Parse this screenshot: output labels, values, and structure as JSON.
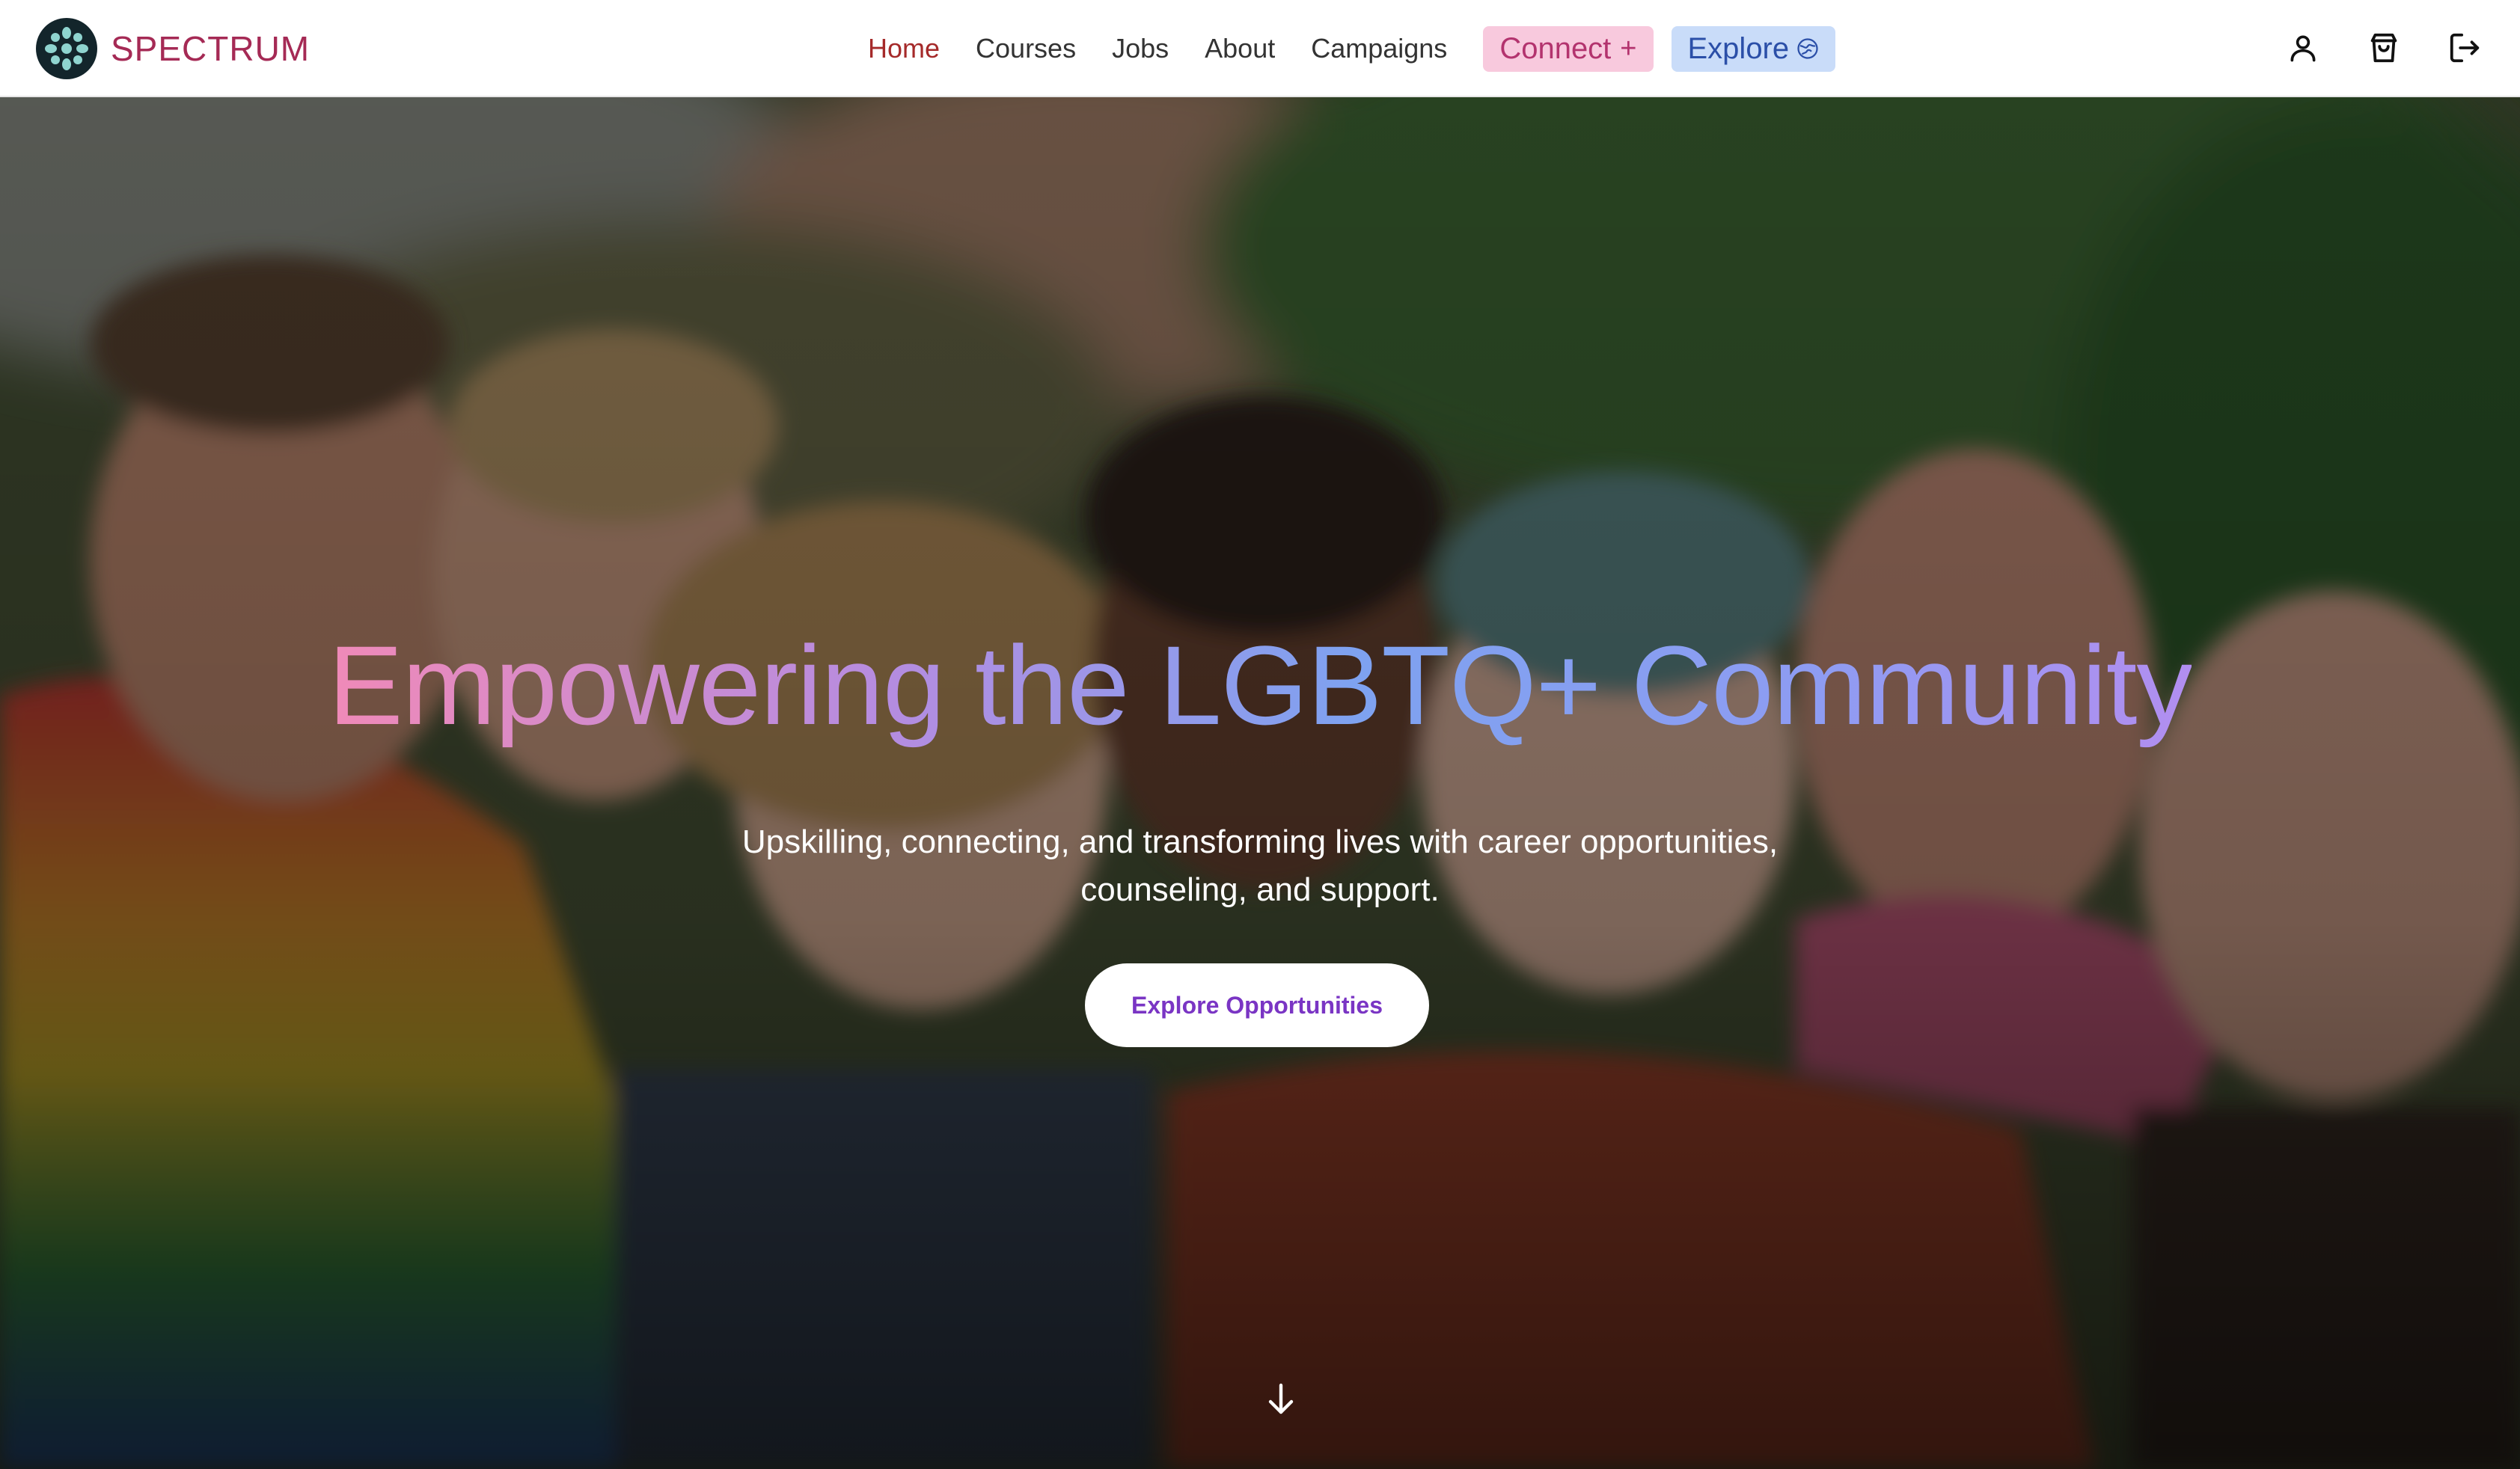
{
  "brand": {
    "name": "SPECTRUM",
    "logo_icon": "spectrum-logo-icon",
    "color": "#a52a55"
  },
  "nav": {
    "links": [
      {
        "label": "Home",
        "active": true
      },
      {
        "label": "Courses",
        "active": false
      },
      {
        "label": "Jobs",
        "active": false
      },
      {
        "label": "About",
        "active": false
      },
      {
        "label": "Campaigns",
        "active": false
      }
    ],
    "connect": {
      "label": "Connect",
      "icon": "plus-icon",
      "bg": "#f8c9dd",
      "color": "#b3336e"
    },
    "explore": {
      "label": "Explore",
      "icon": "globe-icon",
      "bg": "#c9dcf9",
      "color": "#2b4fa8"
    },
    "icons": [
      "user-icon",
      "shopping-bag-icon",
      "logout-icon"
    ]
  },
  "hero": {
    "title": "Empowering the LGBTQ+ Community",
    "subtitle_line1": "Upskilling, connecting, and transforming lives with career opportunities,",
    "subtitle_line2": "counseling, and support.",
    "cta_label": "Explore Opportunities",
    "cta_color": "#7a35c4",
    "scroll_icon": "arrow-down-icon",
    "background": "group-photo"
  }
}
